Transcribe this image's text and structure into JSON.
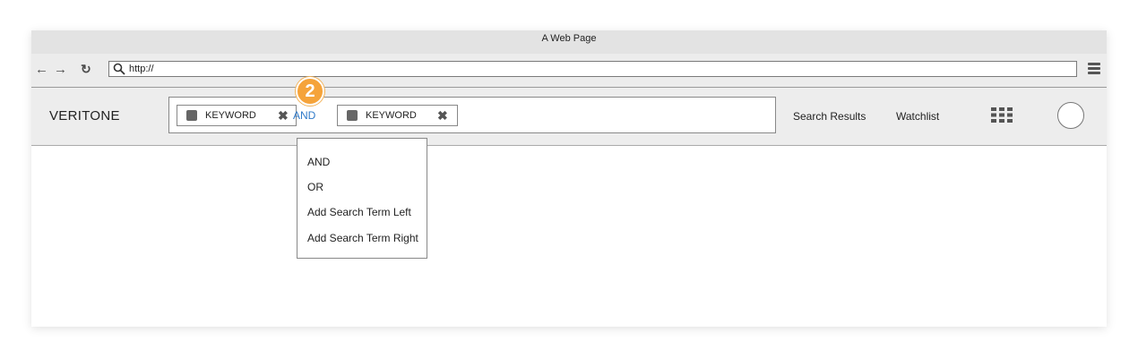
{
  "window": {
    "title": "A Web Page"
  },
  "browser": {
    "back_icon": "arrow-left-icon",
    "forward_icon": "arrow-right-icon",
    "reload_icon": "reload-icon",
    "search_icon": "magnifier-icon",
    "url": "http://",
    "menu_icon": "hamburger-icon"
  },
  "app": {
    "brand": "VERITONE",
    "search": {
      "chips": [
        {
          "label": "KEYWORD",
          "icon": "square-icon",
          "remove_icon": "close-icon"
        },
        {
          "label": "KEYWORD",
          "icon": "square-icon",
          "remove_icon": "close-icon"
        }
      ],
      "operator": "AND",
      "step_badge": "2"
    },
    "nav": {
      "search_results": "Search Results",
      "watchlist": "Watchlist",
      "apps_icon": "grid-icon",
      "avatar_icon": "avatar-icon"
    },
    "dropdown": {
      "items": [
        "AND",
        "OR",
        "Add Search Term Left",
        "Add Search Term Right"
      ]
    }
  },
  "colors": {
    "accent": "#2f7ac9",
    "badge": "#f5a33a"
  }
}
